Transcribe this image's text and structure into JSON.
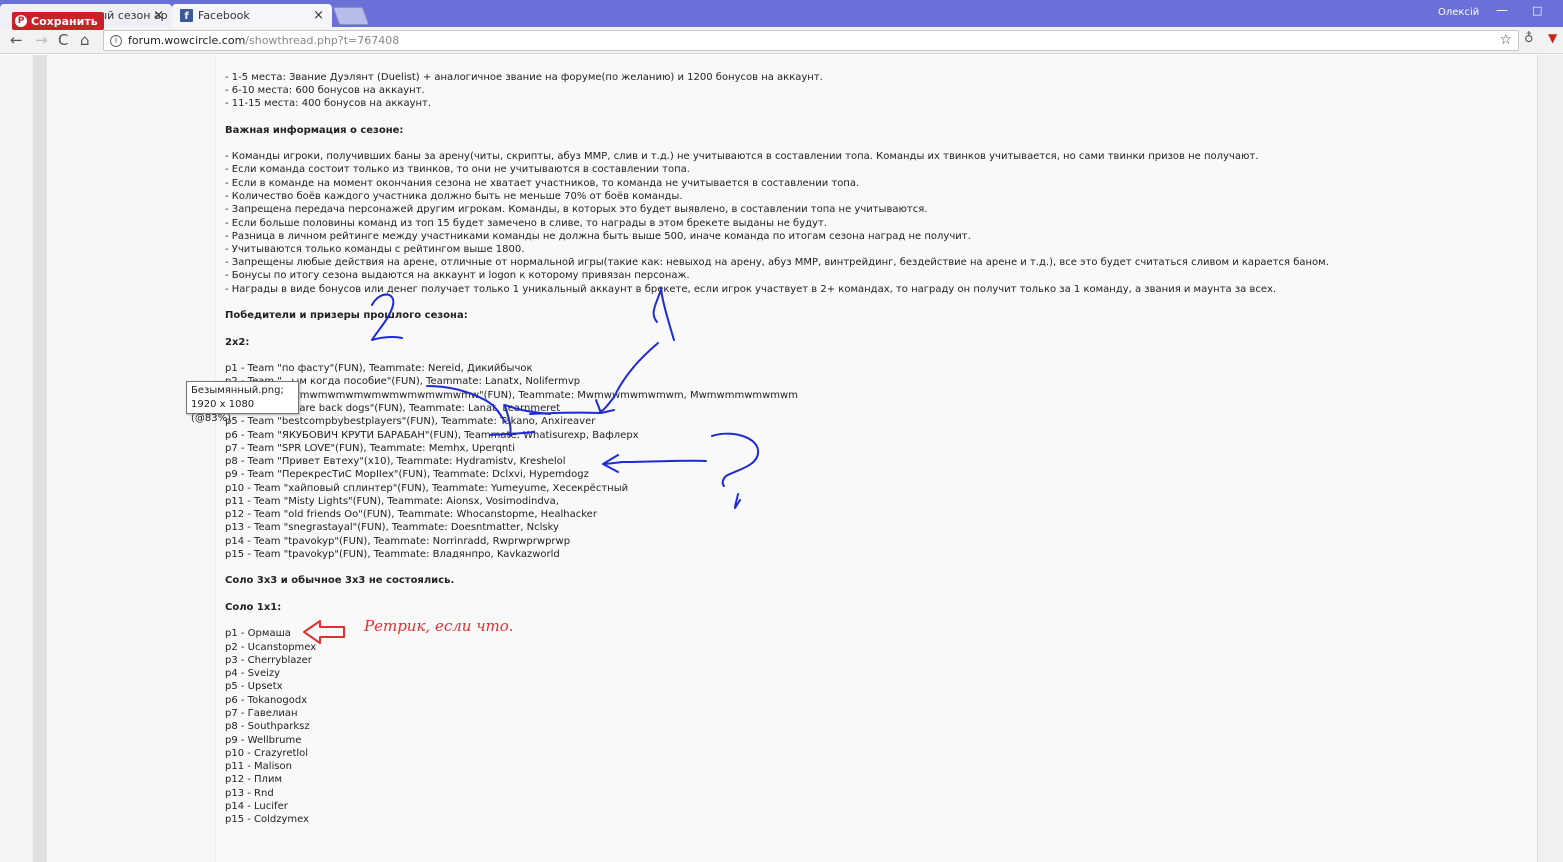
{
  "browser": {
    "tabs": [
      {
        "label": "...ый сезон ар",
        "close": "×"
      },
      {
        "label": "Facebook",
        "close": "×"
      }
    ],
    "pinterest_save": "Сохранить",
    "profile": "Олексій",
    "url_host": "forum.wowcircle.com",
    "url_path": "/showthread.php?t=767408",
    "icons": {
      "back": "←",
      "forward": "→",
      "reload": "C",
      "home": "⌂",
      "info": "i",
      "star": "☆",
      "facebook": "f",
      "pinterest": "P",
      "minimize": "—",
      "maximize": "□"
    }
  },
  "tooltip": {
    "filename": "Безымянный.png;",
    "dimensions": "1920 x 1080 (@83%)"
  },
  "post": {
    "prizes": [
      "- 1-5 места: Звание Дуэлянт (Duelist) + аналогичное звание на форуме(по желанию) и 1200 бонусов на аккаунт.",
      "- 6-10 места: 600 бонусов на аккаунт.",
      "- 11-15 места: 400 бонусов на аккаунт."
    ],
    "info_heading": "Важная информация о сезоне:",
    "info_lines": [
      "- Команды игроки, получивших баны за арену(читы, скрипты, абуз ММР, слив и т.д.) не учитываются в составлении топа. Команды их твинков учитывается, но сами твинки призов не получают.",
      "- Если команда состоит только из твинков, то они не учитываются в составлении топа.",
      "- Если в команде на момент окончания сезона не хватает участников, то команда не учитывается в составлении топа.",
      "- Количество боёв каждого участника должно быть не меньше 70% от боёв команды.",
      "- Запрещена передача персонажей другим игрокам. Команды, в которых это будет выявлено, в составлении топа не учитываются.",
      "- Если больше половины команд из топ 15 будет замечено в сливе, то награды в этом брекете выданы не будут.",
      "- Разница в личном рейтинге между участниками команды не должна быть выше 500, иначе команда по итогам сезона наград не получит.",
      "- Учитываются только команды с рейтингом выше 1800.",
      "- Запрещены любые действия на арене, отличные от нормальной игры(такие как: невыход на арену, абуз ММР, винтрейдинг, бездействие на арене и т.д.), все это будет считаться сливом и карается баном.",
      "- Бонусы по итогу сезона выдаются на аккаунт и logon к которому привязан персонаж.",
      "- Награды в виде бонусов или денег получает только 1 уникальный аккаунт в брекете, если игрок участвует в 2+ командах, то награду он получит только за 1 команду, а звания и маунта за всех."
    ],
    "winners_heading": "Победители и призеры прошлого сезона:",
    "bracket_2x2": "2x2:",
    "teams_2x2": [
      "p1 - Team \"по фасту\"(FUN), Teammate: Nereid, Дикийбычок",
      "p2 - Team \"...ым когда пособие\"(FUN), Teammate: Lanatx, Nolifermvp",
      "p3 - Team \"mwmwmwmwmwmwmwmwmwmwmw\"(FUN), Teammate: Mwmwwmwmwmwm, Mwmwmmwmwmwm",
      "p4 - Team \"we are back dogs\"(FUN), Teammate: Lanat, Learnmeret",
      "p5 - Team \"bestcompbybestplayers\"(FUN), Teammate: Takano, Anxireaver",
      "p6 - Team \"ЯКУБОВИЧ КРУТИ БАРАБАН\"(FUN), Teammate: Whatisurexp, Вафлерх",
      "p7 - Team \"SPR LOVE\"(FUN), Teammate: Memhx, Uperqnti",
      "p8 - Team \"Привет Евтеху\"(x10), Teammate: Hydramistv, Kreshelol",
      "p9 - Team \"ПерекресТиС МорIIех\"(FUN), Teammate: Dclxvi, Hypemdogz",
      "p10 - Team \"хайповый сплинтер\"(FUN), Teammate: Yumeyume, Хесекрёстный",
      "p11 - Team \"Misty Lights\"(FUN), Teammate: Aionsx, Vosimodindva,",
      "p12 - Team \"old friends Oo\"(FUN), Teammate: Whocanstopme, Healhacker",
      "p13 - Team \"snegrastayal\"(FUN), Teammate: Doesntmatter, Nclsky",
      "p14 - Team \"tpavokyp\"(FUN), Teammate: Norrinradd, Rwprwprwprwp",
      "p15 - Team \"tpavokyp\"(FUN), Teammate: Владянпро, Kavkazworld"
    ],
    "no_3x3": "Соло 3х3 и обычное 3х3 не состоялись.",
    "bracket_1x1": "Соло 1х1:",
    "solo_1x1": [
      "p1 - Ормаша",
      "p2 - Ucanstopmex",
      "p3 - Cherryblazer",
      "p4 - Sveizy",
      "p5 - Upsetx",
      "p6 - Tokanogodx",
      "p7 - Гавелиан",
      "p8 - Southparksz",
      "p9 - Wellbrume",
      "p10 - Crazyretlol",
      "p11 - Malison",
      "p12 - Плим",
      "p13 - Rnd",
      "p14 - Lucifer",
      "p15 - Coldzymex"
    ]
  },
  "annotations": {
    "red_note": "Ретрик, если что.",
    "blue_number": "2",
    "blue_question": "?",
    "blue_color": "#1d2bd8",
    "red_color": "#e03030"
  }
}
